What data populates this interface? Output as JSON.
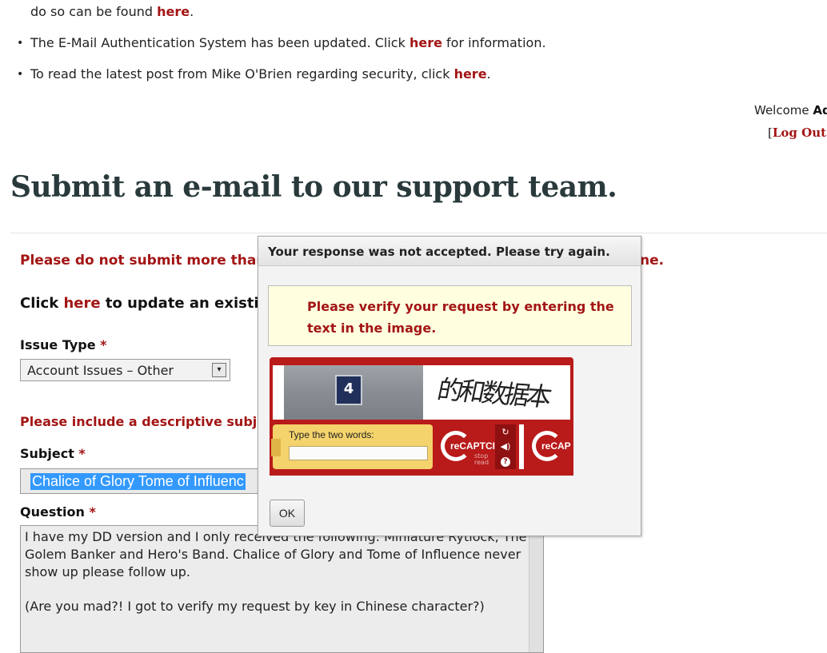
{
  "notices": {
    "item0_text": "do so can be found ",
    "item0_link": "here",
    "item0_end": ".",
    "item1_text": "The E-Mail Authentication System has been updated. Click ",
    "item1_link": "here",
    "item1_end": " for information.",
    "item2_text": "To read the latest post from Mike O'Brien regarding security, click ",
    "item2_link": "here",
    "item2_end": "."
  },
  "account": {
    "welcome_label": "Welcome ",
    "username": "Adr",
    "bracket_open": "[",
    "logout_label": "Log Out o"
  },
  "page": {
    "title": "Submit an e-mail to our support team.",
    "warning_start": "Please do not submit more than o",
    "warning_end": "ne.",
    "update_prefix": "Click ",
    "update_link": "here",
    "update_suffix": " to update an existing ti"
  },
  "form": {
    "issue_type_label": "Issue Type",
    "required_mark": "*",
    "issue_type_value": "Account Issues – Other",
    "subject_hint": "Please include a descriptive subject line",
    "subject_label": "Subject",
    "subject_value": "Chalice of Glory Tome of Influenc",
    "question_label": "Question",
    "question_line1": "I have my DD version and I only received the following: Miniature Rytlock, The Golem Banker and Hero's Band. Chalice of Glory and Tome of Influence never show up please follow up.",
    "question_line2": "(Are you mad?! I got to verify my request by key in Chinese character?)"
  },
  "dialog": {
    "title": "Your response was not accepted. Please try again.",
    "message": "Please verify your request by entering the text in the image.",
    "ok_label": "OK"
  },
  "recaptcha": {
    "prompt": "Type the two words:",
    "plate_number": "4",
    "challenge_text": "的和数据本",
    "logo_text": "reCAPTCI",
    "logo_text2": "reCAP",
    "logo_sub": "stop\nread",
    "icons": [
      "refresh-icon",
      "audio-icon",
      "help-icon"
    ]
  },
  "colors": {
    "link": "#a31515",
    "title": "#2a3a3c",
    "recaptcha_red": "#b91a1a",
    "notice_bg": "#ffffe0",
    "selection": "#3399ff"
  }
}
